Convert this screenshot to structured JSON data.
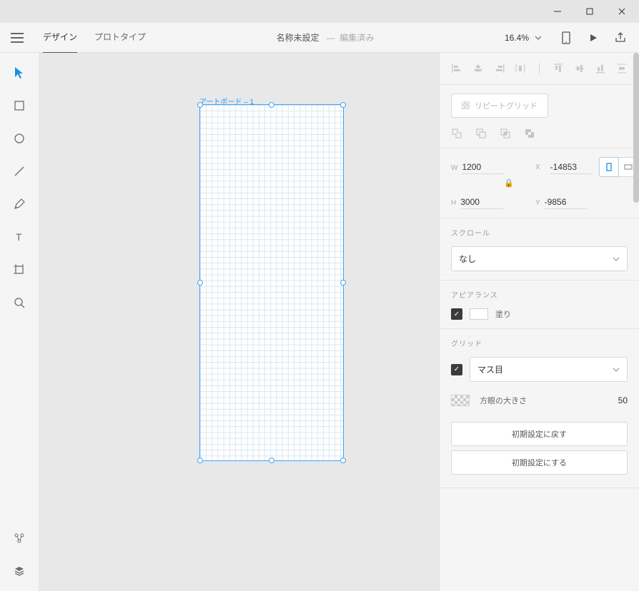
{
  "window": {
    "title": ""
  },
  "topbar": {
    "tabs": {
      "design": "デザイン",
      "prototype": "プロトタイプ"
    },
    "doc_title": "名称未設定",
    "separator": "—",
    "edited": "編集済み",
    "zoom": "16.4%"
  },
  "artboard": {
    "name": "アートボード – 1"
  },
  "panel": {
    "repeat_grid": "リピートグリッド",
    "transform": {
      "w_label": "W",
      "w": "1200",
      "h_label": "H",
      "h": "3000",
      "x_label": "X",
      "x": "-14853",
      "y_label": "Y",
      "y": "-9856"
    },
    "scroll": {
      "title": "スクロール",
      "value": "なし"
    },
    "appearance": {
      "title": "アピアランス",
      "fill_label": "塗り"
    },
    "grid": {
      "title": "グリッド",
      "type_value": "マス目",
      "size_label": "方眼の大きさ",
      "size_value": "50"
    },
    "reset_default": "初期設定に戻す",
    "make_default": "初期設定にする"
  }
}
